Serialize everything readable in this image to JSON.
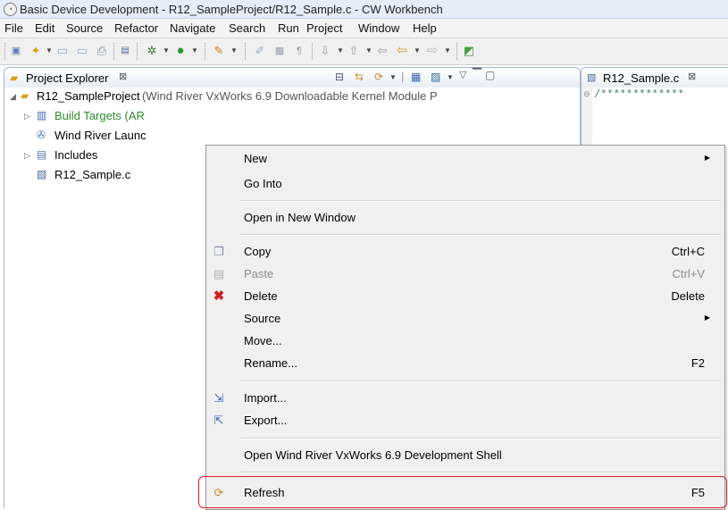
{
  "window": {
    "title": "Basic Device Development - R12_SampleProject/R12_Sample.c - CW Workbench"
  },
  "menubar": [
    "File",
    "Edit",
    "Source",
    "Refactor",
    "Navigate",
    "Search",
    "Run",
    "Project",
    "Window",
    "Help"
  ],
  "project_explorer": {
    "tab_label": "Project Explorer",
    "tree": [
      {
        "label": "R12_SampleProject",
        "suffix": "(Wind River VxWorks 6.9 Downloadable Kernel Module P",
        "icon": "project-icon",
        "expanded": true
      },
      {
        "label": "Build Targets (AR",
        "icon": "build-targets-icon",
        "color": "#2e8b2e"
      },
      {
        "label": "Wind River Launc",
        "icon": "launch-icon"
      },
      {
        "label": "Includes",
        "icon": "includes-icon"
      },
      {
        "label": "R12_Sample.c",
        "icon": "c-file-icon"
      }
    ]
  },
  "editor": {
    "tab_label": "R12_Sample.c",
    "first_line": "/*************"
  },
  "context_menu": {
    "items": [
      {
        "label": "New",
        "submenu": true
      },
      {
        "label": "Go Into"
      },
      {
        "label": "Open in New Window"
      },
      {
        "label": "Copy",
        "shortcut": "Ctrl+C",
        "icon": "copy-icon"
      },
      {
        "label": "Paste",
        "shortcut": "Ctrl+V",
        "icon": "paste-icon",
        "disabled": true
      },
      {
        "label": "Delete",
        "shortcut": "Delete",
        "icon": "delete-icon"
      },
      {
        "label": "Source",
        "submenu": true
      },
      {
        "label": "Move..."
      },
      {
        "label": "Rename...",
        "shortcut": "F2"
      },
      {
        "label": "Import...",
        "icon": "import-icon"
      },
      {
        "label": "Export...",
        "icon": "export-icon"
      },
      {
        "label": "Open Wind River VxWorks 6.9 Development Shell"
      },
      {
        "label": "Refresh",
        "shortcut": "F5",
        "icon": "refresh-icon",
        "highlighted": true
      }
    ]
  },
  "colors": {
    "highlight_box": "#e0202a",
    "build_targets_text": "#2e8b2e"
  }
}
